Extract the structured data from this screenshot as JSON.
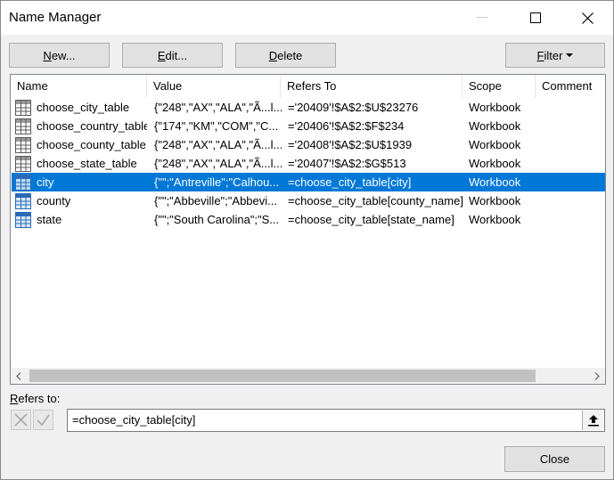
{
  "window": {
    "title": "Name Manager"
  },
  "toolbar": {
    "new_label": "ew...",
    "new_key": "N",
    "edit_label": "dit...",
    "edit_key": "E",
    "delete_label": "elete",
    "delete_key": "D",
    "filter_label": "ilter",
    "filter_key": "F"
  },
  "columns": [
    "Name",
    "Value",
    "Refers To",
    "Scope",
    "Comment"
  ],
  "rows": [
    {
      "name": "choose_city_table",
      "value": "{\"248\",\"AX\",\"ALA\",\"Ã...l...",
      "refers": "='20409'!$A$2:$U$23276",
      "scope": "Workbook",
      "comment": "",
      "icon": "table-icon"
    },
    {
      "name": "choose_country_table",
      "value": "{\"174\",\"KM\",\"COM\",\"C...",
      "refers": "='20406'!$A$2:$F$234",
      "scope": "Workbook",
      "comment": "",
      "icon": "table-icon"
    },
    {
      "name": "choose_county_table",
      "value": "{\"248\",\"AX\",\"ALA\",\"Ã...l...",
      "refers": "='20408'!$A$2:$U$1939",
      "scope": "Workbook",
      "comment": "",
      "icon": "table-icon"
    },
    {
      "name": "choose_state_table",
      "value": "{\"248\",\"AX\",\"ALA\",\"Ã...l...",
      "refers": "='20407'!$A$2:$G$513",
      "scope": "Workbook",
      "comment": "",
      "icon": "table-icon"
    },
    {
      "name": "city",
      "value": "{\"\";\"Antreville\";\"Calhou...",
      "refers": "=choose_city_table[city]",
      "scope": "Workbook",
      "comment": "",
      "icon": "name-icon",
      "selected": true
    },
    {
      "name": "county",
      "value": "{\"\";\"Abbeville\";\"Abbevi...",
      "refers": "=choose_city_table[county_name]",
      "scope": "Workbook",
      "comment": "",
      "icon": "name-icon"
    },
    {
      "name": "state",
      "value": "{\"\";\"South Carolina\";\"S...",
      "refers": "=choose_city_table[state_name]",
      "scope": "Workbook",
      "comment": "",
      "icon": "name-icon"
    }
  ],
  "refers_to": {
    "label_key": "R",
    "label_rest": "efers to:",
    "value": "=choose_city_table[city]"
  },
  "close_label": "Close",
  "colors": {
    "selection": "#0078d7",
    "button_bg": "#e1e1e1"
  }
}
